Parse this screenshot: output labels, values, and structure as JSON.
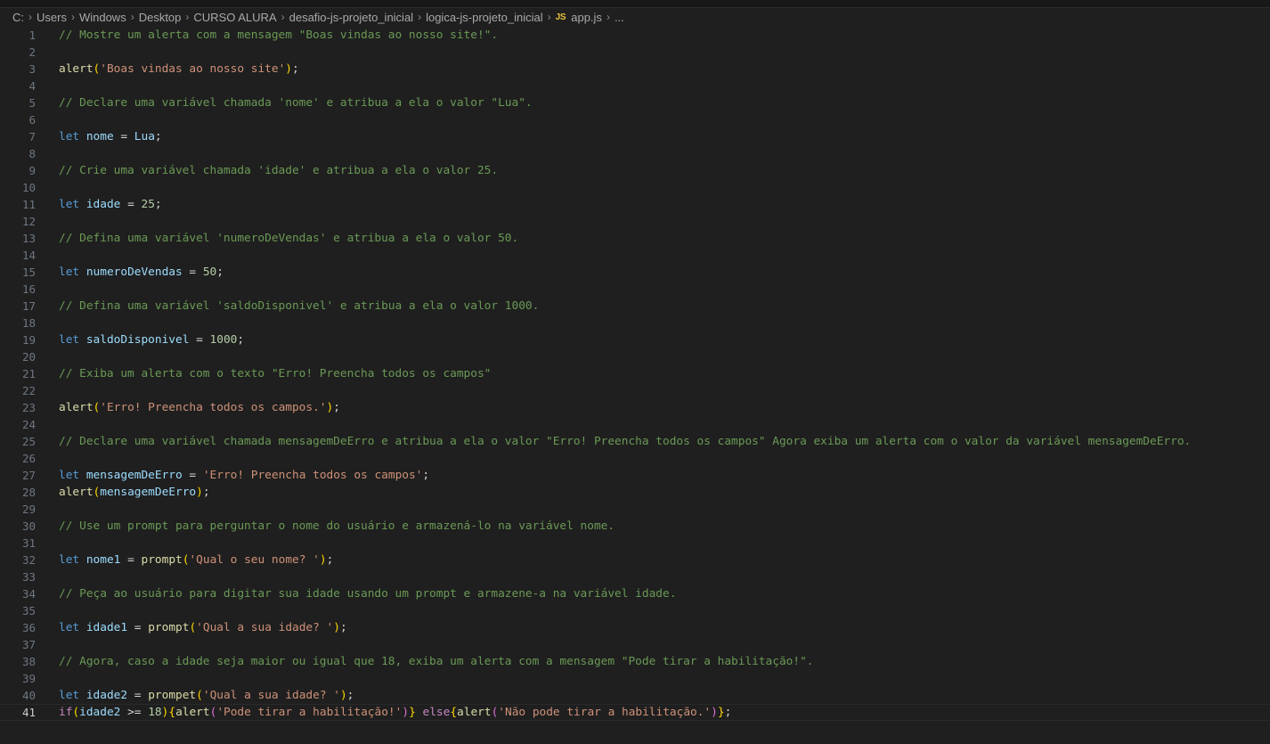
{
  "breadcrumb": {
    "parts": [
      "C:",
      "Users",
      "Windows",
      "Desktop",
      "CURSO ALURA",
      "desafio-js-projeto_inicial",
      "logica-js-projeto_inicial"
    ],
    "file_icon": "JS",
    "file": "app.js",
    "ellipsis": "..."
  },
  "active_line": 41,
  "colors": {
    "background": "#1f1f1f",
    "comment": "#6a9955",
    "keyword": "#569cd6",
    "control": "#c586c0",
    "variable": "#9cdcfe",
    "function": "#dcdcaa",
    "string": "#ce9178",
    "number": "#b5cea8"
  },
  "code": [
    {
      "n": "1",
      "tokens": [
        [
          "c",
          "// Mostre um alerta com a mensagem \"Boas vindas ao nosso site!\"."
        ]
      ]
    },
    {
      "n": "2",
      "tokens": []
    },
    {
      "n": "3",
      "tokens": [
        [
          "f",
          "alert"
        ],
        [
          "b1",
          "("
        ],
        [
          "s",
          "'Boas vindas ao nosso site'"
        ],
        [
          "b1",
          ")"
        ],
        [
          "p",
          ";"
        ]
      ]
    },
    {
      "n": "4",
      "tokens": []
    },
    {
      "n": "5",
      "tokens": [
        [
          "c",
          "// Declare uma variável chamada 'nome' e atribua a ela o valor \"Lua\"."
        ]
      ]
    },
    {
      "n": "6",
      "tokens": []
    },
    {
      "n": "7",
      "tokens": [
        [
          "k",
          "let"
        ],
        [
          "p",
          " "
        ],
        [
          "v",
          "nome"
        ],
        [
          "p",
          " = "
        ],
        [
          "v",
          "Lua"
        ],
        [
          "p",
          ";"
        ]
      ]
    },
    {
      "n": "8",
      "tokens": []
    },
    {
      "n": "9",
      "tokens": [
        [
          "c",
          "// Crie uma variável chamada 'idade' e atribua a ela o valor 25."
        ]
      ]
    },
    {
      "n": "10",
      "tokens": []
    },
    {
      "n": "11",
      "tokens": [
        [
          "k",
          "let"
        ],
        [
          "p",
          " "
        ],
        [
          "v",
          "idade"
        ],
        [
          "p",
          " = "
        ],
        [
          "n",
          "25"
        ],
        [
          "p",
          ";"
        ]
      ]
    },
    {
      "n": "12",
      "tokens": []
    },
    {
      "n": "13",
      "tokens": [
        [
          "c",
          "// Defina uma variável 'numeroDeVendas' e atribua a ela o valor 50."
        ]
      ]
    },
    {
      "n": "14",
      "tokens": []
    },
    {
      "n": "15",
      "tokens": [
        [
          "k",
          "let"
        ],
        [
          "p",
          " "
        ],
        [
          "v",
          "numeroDeVendas"
        ],
        [
          "p",
          " = "
        ],
        [
          "n",
          "50"
        ],
        [
          "p",
          ";"
        ]
      ]
    },
    {
      "n": "16",
      "tokens": []
    },
    {
      "n": "17",
      "tokens": [
        [
          "c",
          "// Defina uma variável 'saldoDisponivel' e atribua a ela o valor 1000."
        ]
      ]
    },
    {
      "n": "18",
      "tokens": []
    },
    {
      "n": "19",
      "tokens": [
        [
          "k",
          "let"
        ],
        [
          "p",
          " "
        ],
        [
          "v",
          "saldoDisponivel"
        ],
        [
          "p",
          " = "
        ],
        [
          "n",
          "1000"
        ],
        [
          "p",
          ";"
        ]
      ]
    },
    {
      "n": "20",
      "tokens": []
    },
    {
      "n": "21",
      "tokens": [
        [
          "c",
          "// Exiba um alerta com o texto \"Erro! Preencha todos os campos\""
        ]
      ]
    },
    {
      "n": "22",
      "tokens": []
    },
    {
      "n": "23",
      "tokens": [
        [
          "f",
          "alert"
        ],
        [
          "b1",
          "("
        ],
        [
          "s",
          "'Erro! Preencha todos os campos.'"
        ],
        [
          "b1",
          ")"
        ],
        [
          "p",
          ";"
        ]
      ]
    },
    {
      "n": "24",
      "tokens": []
    },
    {
      "n": "25",
      "tokens": [
        [
          "c",
          "// Declare uma variável chamada mensagemDeErro e atribua a ela o valor \"Erro! Preencha todos os campos\" Agora exiba um alerta com o valor da variável mensagemDeErro."
        ]
      ]
    },
    {
      "n": "26",
      "tokens": []
    },
    {
      "n": "27",
      "tokens": [
        [
          "k",
          "let"
        ],
        [
          "p",
          " "
        ],
        [
          "v",
          "mensagemDeErro"
        ],
        [
          "p",
          " = "
        ],
        [
          "s",
          "'Erro! Preencha todos os campos'"
        ],
        [
          "p",
          ";"
        ]
      ]
    },
    {
      "n": "28",
      "tokens": [
        [
          "f",
          "alert"
        ],
        [
          "b1",
          "("
        ],
        [
          "v",
          "mensagemDeErro"
        ],
        [
          "b1",
          ")"
        ],
        [
          "p",
          ";"
        ]
      ]
    },
    {
      "n": "29",
      "tokens": []
    },
    {
      "n": "30",
      "tokens": [
        [
          "c",
          "// Use um prompt para perguntar o nome do usuário e armazená-lo na variável nome."
        ]
      ]
    },
    {
      "n": "31",
      "tokens": []
    },
    {
      "n": "32",
      "tokens": [
        [
          "k",
          "let"
        ],
        [
          "p",
          " "
        ],
        [
          "v",
          "nome1"
        ],
        [
          "p",
          " = "
        ],
        [
          "f",
          "prompt"
        ],
        [
          "b1",
          "("
        ],
        [
          "s",
          "'Qual o seu nome? '"
        ],
        [
          "b1",
          ")"
        ],
        [
          "p",
          ";"
        ]
      ]
    },
    {
      "n": "33",
      "tokens": []
    },
    {
      "n": "34",
      "tokens": [
        [
          "c",
          "// Peça ao usuário para digitar sua idade usando um prompt e armazene-a na variável idade."
        ]
      ]
    },
    {
      "n": "35",
      "tokens": []
    },
    {
      "n": "36",
      "tokens": [
        [
          "k",
          "let"
        ],
        [
          "p",
          " "
        ],
        [
          "v",
          "idade1"
        ],
        [
          "p",
          " = "
        ],
        [
          "f",
          "prompt"
        ],
        [
          "b1",
          "("
        ],
        [
          "s",
          "'Qual a sua idade? '"
        ],
        [
          "b1",
          ")"
        ],
        [
          "p",
          ";"
        ]
      ]
    },
    {
      "n": "37",
      "tokens": []
    },
    {
      "n": "38",
      "tokens": [
        [
          "c",
          "// Agora, caso a idade seja maior ou igual que 18, exiba um alerta com a mensagem \"Pode tirar a habilitação!\"."
        ]
      ]
    },
    {
      "n": "39",
      "tokens": []
    },
    {
      "n": "40",
      "tokens": [
        [
          "k",
          "let"
        ],
        [
          "p",
          " "
        ],
        [
          "v",
          "idade2"
        ],
        [
          "p",
          " = "
        ],
        [
          "f",
          "prompet"
        ],
        [
          "b1",
          "("
        ],
        [
          "s",
          "'Qual a sua idade? '"
        ],
        [
          "b1",
          ")"
        ],
        [
          "p",
          ";"
        ]
      ]
    },
    {
      "n": "41",
      "tokens": [
        [
          "ctl",
          "if"
        ],
        [
          "b1",
          "("
        ],
        [
          "v",
          "idade2"
        ],
        [
          "p",
          " >= "
        ],
        [
          "n",
          "18"
        ],
        [
          "b1",
          ")"
        ],
        [
          "b1",
          "{"
        ],
        [
          "f",
          "alert"
        ],
        [
          "b2",
          "("
        ],
        [
          "s",
          "'Pode tirar a habilitação!'"
        ],
        [
          "b2",
          ")"
        ],
        [
          "b1",
          "}"
        ],
        [
          "p",
          " "
        ],
        [
          "ctl",
          "else"
        ],
        [
          "b1",
          "{"
        ],
        [
          "f",
          "alert"
        ],
        [
          "b2",
          "("
        ],
        [
          "s",
          "'Não pode tirar a habilitação.'"
        ],
        [
          "b2",
          ")"
        ],
        [
          "b1",
          "}"
        ],
        [
          "p",
          ";"
        ]
      ]
    }
  ]
}
